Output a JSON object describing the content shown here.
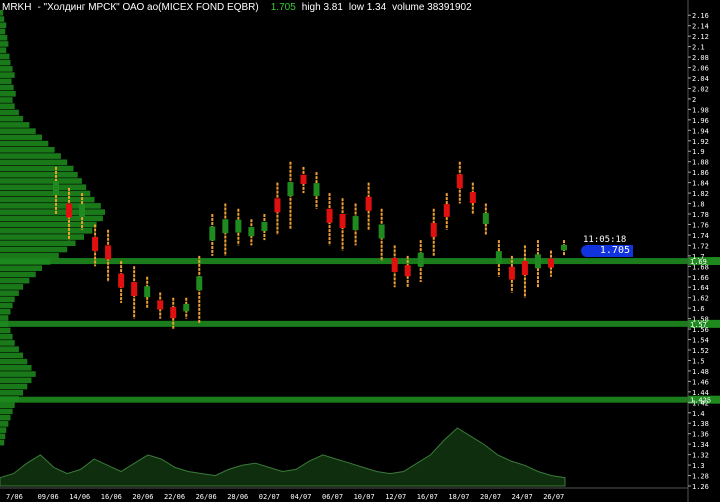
{
  "header": {
    "symbol": "MRKH",
    "name": "- \"Холдинг МРСК\" ОАО ао(MICEX FOND EQBR)",
    "last": "1.705",
    "high_label": "high 3.81",
    "low_label": "low 1.34",
    "volume_label": "volume 38391902"
  },
  "clock": "11:05:18",
  "price_badge": "1.705",
  "colors": {
    "up": "#1f8a1f",
    "down": "#e01010",
    "wick": "#f0a030",
    "level": "#1e8a1e",
    "profile": "#1a7a1a",
    "volume_fill": "#0e2e0e",
    "volume_line": "#3a7a3a"
  },
  "chart_data": {
    "type": "candlestick",
    "y_ticks": [
      "2.16",
      "2.14",
      "2.12",
      "2.1",
      "2.08",
      "2.06",
      "2.04",
      "2.02",
      "2",
      "1.98",
      "1.96",
      "1.94",
      "1.92",
      "1.9",
      "1.88",
      "1.86",
      "1.84",
      "1.82",
      "1.8",
      "1.78",
      "1.76",
      "1.74",
      "1.72",
      "1.7",
      "1.68",
      "1.66",
      "1.64",
      "1.62",
      "1.6",
      "1.58",
      "1.56",
      "1.54",
      "1.52",
      "1.5",
      "1.48",
      "1.46",
      "1.44",
      "1.42",
      "1.4",
      "1.38",
      "1.36",
      "1.34",
      "1.32",
      "1.3",
      "1.28",
      "1.26"
    ],
    "x_ticks": [
      "7/06",
      "09/06",
      "14/06",
      "16/06",
      "20/06",
      "22/06",
      "26/06",
      "28/06",
      "02/07",
      "04/07",
      "06/07",
      "10/07",
      "12/07",
      "16/07",
      "18/07",
      "20/07",
      "24/07",
      "26/07"
    ],
    "levels": [
      1.69,
      1.57,
      1.425
    ],
    "level_labels": [
      "1.69",
      "1.57",
      "1.425"
    ],
    "ylim": [
      1.26,
      2.17
    ],
    "candles": [
      [
        1.87,
        1.78,
        "up"
      ],
      [
        1.83,
        1.73,
        "down"
      ],
      [
        1.82,
        1.75,
        "up"
      ],
      [
        1.76,
        1.68,
        "down"
      ],
      [
        1.75,
        1.65,
        "down"
      ],
      [
        1.69,
        1.61,
        "down"
      ],
      [
        1.68,
        1.58,
        "down"
      ],
      [
        1.66,
        1.6,
        "up"
      ],
      [
        1.63,
        1.58,
        "down"
      ],
      [
        1.62,
        1.56,
        "down"
      ],
      [
        1.62,
        1.58,
        "up"
      ],
      [
        1.7,
        1.57,
        "up"
      ],
      [
        1.78,
        1.7,
        "up"
      ],
      [
        1.8,
        1.7,
        "up"
      ],
      [
        1.79,
        1.72,
        "up"
      ],
      [
        1.77,
        1.72,
        "up"
      ],
      [
        1.78,
        1.73,
        "up"
      ],
      [
        1.84,
        1.74,
        "down"
      ],
      [
        1.88,
        1.75,
        "up"
      ],
      [
        1.87,
        1.82,
        "down"
      ],
      [
        1.86,
        1.79,
        "up"
      ],
      [
        1.82,
        1.72,
        "down"
      ],
      [
        1.81,
        1.71,
        "down"
      ],
      [
        1.8,
        1.72,
        "up"
      ],
      [
        1.84,
        1.75,
        "down"
      ],
      [
        1.79,
        1.69,
        "up"
      ],
      [
        1.72,
        1.64,
        "down"
      ],
      [
        1.7,
        1.64,
        "down"
      ],
      [
        1.73,
        1.65,
        "up"
      ],
      [
        1.79,
        1.7,
        "down"
      ],
      [
        1.82,
        1.75,
        "down"
      ],
      [
        1.88,
        1.8,
        "down"
      ],
      [
        1.84,
        1.78,
        "down"
      ],
      [
        1.8,
        1.74,
        "up"
      ],
      [
        1.73,
        1.66,
        "up"
      ],
      [
        1.7,
        1.63,
        "down"
      ],
      [
        1.72,
        1.62,
        "down"
      ],
      [
        1.73,
        1.64,
        "up"
      ],
      [
        1.71,
        1.66,
        "down"
      ],
      [
        1.73,
        1.7,
        "up"
      ]
    ],
    "profile": [
      3,
      4,
      6,
      5,
      7,
      8,
      6,
      9,
      10,
      12,
      14,
      11,
      13,
      15,
      12,
      14,
      18,
      22,
      28,
      34,
      40,
      46,
      52,
      58,
      64,
      70,
      74,
      78,
      82,
      86,
      90,
      96,
      100,
      98,
      92,
      88,
      80,
      72,
      64,
      56,
      48,
      40,
      34,
      28,
      22,
      18,
      14,
      12,
      10,
      8,
      8,
      10,
      12,
      14,
      18,
      22,
      26,
      30,
      34,
      30,
      26,
      22,
      18,
      14,
      12,
      10,
      8,
      6,
      5,
      4
    ],
    "volume": [
      8,
      12,
      22,
      30,
      18,
      12,
      16,
      26,
      20,
      14,
      22,
      30,
      26,
      18,
      14,
      12,
      10,
      16,
      20,
      22,
      18,
      14,
      16,
      24,
      30,
      26,
      22,
      18,
      14,
      12,
      14,
      22,
      30,
      44,
      56,
      48,
      40,
      30,
      24,
      20,
      14,
      10,
      8
    ]
  }
}
